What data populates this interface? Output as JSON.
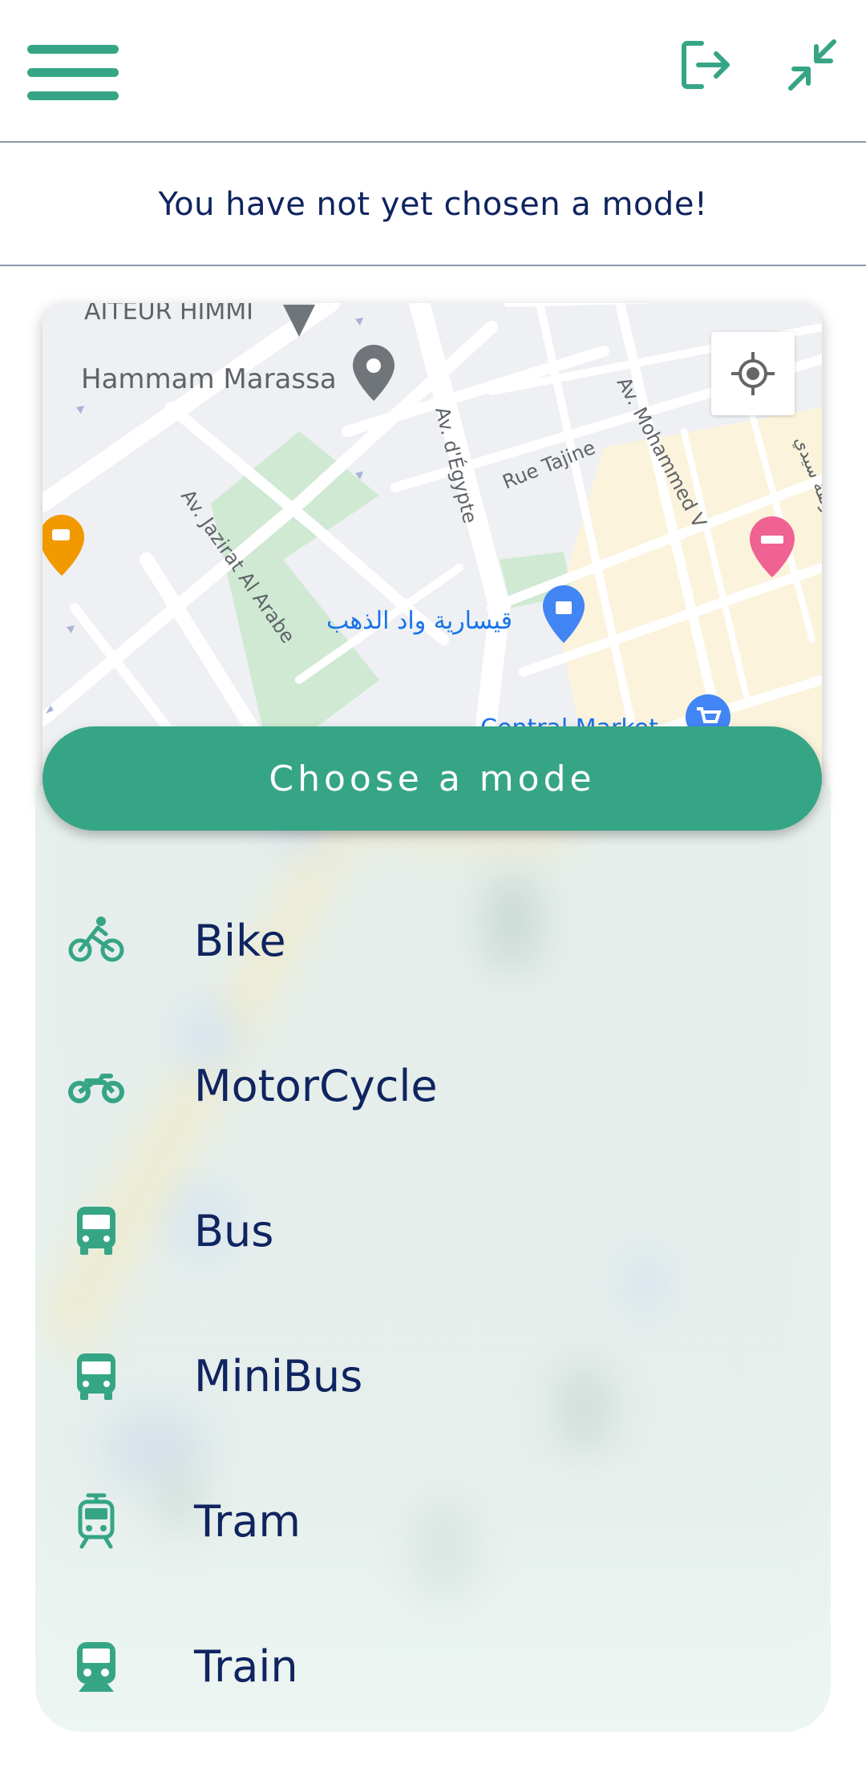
{
  "status": {
    "message": "You have not yet chosen a mode!"
  },
  "map": {
    "labels": {
      "traiteur": "AITEUR HIMMI",
      "hammam": "Hammam Marassa",
      "egypte": "Av. d'Égypte",
      "tajine": "Rue Tajine",
      "mohammed": "Av. Mohammed V",
      "jazirat": "Av. Jazirat Al Arabe",
      "kissaria": "قيسارية واد الذهب",
      "market": "Central Market",
      "zanqa": "زنقة سيدي"
    }
  },
  "choose_button": {
    "label": "Choose a mode"
  },
  "modes": [
    {
      "label": "Bike",
      "icon": "bike-icon"
    },
    {
      "label": "MotorCycle",
      "icon": "motorcycle-icon"
    },
    {
      "label": "Bus",
      "icon": "bus-icon"
    },
    {
      "label": "MiniBus",
      "icon": "minibus-icon"
    },
    {
      "label": "Tram",
      "icon": "tram-icon"
    },
    {
      "label": "Train",
      "icon": "train-icon"
    }
  ],
  "colors": {
    "accent": "#36a585",
    "text": "#0f2460",
    "divider": "#8c98ad"
  }
}
